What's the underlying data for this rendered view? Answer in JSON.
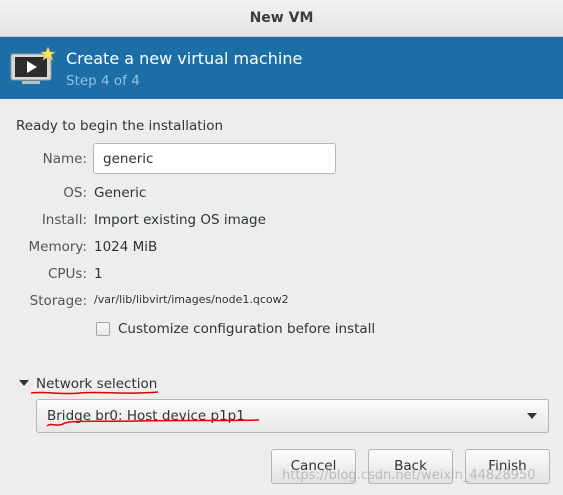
{
  "window": {
    "title": "New VM"
  },
  "banner": {
    "title": "Create a new virtual machine",
    "step": "Step 4 of 4",
    "icon": "monitor-play-icon"
  },
  "summary": {
    "heading": "Ready to begin the installation",
    "name_label": "Name:",
    "name_value": "generic",
    "os_label": "OS:",
    "os_value": "Generic",
    "install_label": "Install:",
    "install_value": "Import existing OS image",
    "memory_label": "Memory:",
    "memory_value": "1024 MiB",
    "cpus_label": "CPUs:",
    "cpus_value": "1",
    "storage_label": "Storage:",
    "storage_value": "/var/lib/libvirt/images/node1.qcow2",
    "customize_label": "Customize configuration before install",
    "customize_checked": false
  },
  "network": {
    "expander_label": "Network selection",
    "expanded": true,
    "selected": "Bridge br0: Host device p1p1"
  },
  "buttons": {
    "cancel": "Cancel",
    "back": "Back",
    "finish": "Finish"
  },
  "watermark": "https://blog.csdn.net/weixin_44828950",
  "colors": {
    "banner_bg": "#1c6ea6",
    "step_text": "#8fc1e6",
    "annotation_red": "#e00000"
  }
}
